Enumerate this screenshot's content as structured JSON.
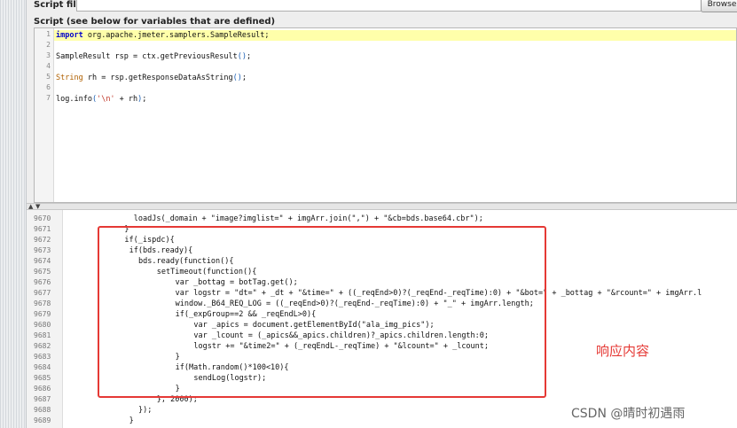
{
  "header": {
    "script_file_label": "Script file",
    "browse_label": "Browse",
    "script_label": "Script (see below for variables that are defined)"
  },
  "editor": {
    "lines": [
      {
        "num": "1",
        "parts": [
          {
            "t": "import",
            "c": "kw"
          },
          {
            "t": " org.apache.jmeter.samplers.SampleResult;",
            "c": ""
          }
        ]
      },
      {
        "num": "2",
        "parts": []
      },
      {
        "num": "3",
        "parts": [
          {
            "t": "SampleResult rsp = ctx.getPreviousResult",
            "c": ""
          },
          {
            "t": "()",
            "c": "paren"
          },
          {
            "t": ";",
            "c": ""
          }
        ]
      },
      {
        "num": "4",
        "parts": []
      },
      {
        "num": "5",
        "parts": [
          {
            "t": "String",
            "c": "type"
          },
          {
            "t": " rh = rsp.getResponseDataAsString",
            "c": ""
          },
          {
            "t": "()",
            "c": "paren"
          },
          {
            "t": ";",
            "c": ""
          }
        ]
      },
      {
        "num": "6",
        "parts": []
      },
      {
        "num": "7",
        "parts": [
          {
            "t": "log.info",
            "c": ""
          },
          {
            "t": "(",
            "c": "paren"
          },
          {
            "t": "'\\n'",
            "c": "str"
          },
          {
            "t": " + rh",
            "c": ""
          },
          {
            "t": ")",
            "c": "paren"
          },
          {
            "t": ";",
            "c": ""
          }
        ]
      }
    ]
  },
  "response": {
    "lines": [
      {
        "num": "9670",
        "indent": 14,
        "text": "loadJs(_domain + \"image?imglist=\" + imgArr.join(\",\") + \"&cb=bds.base64.cbr\");"
      },
      {
        "num": "9671",
        "indent": 12,
        "text": "}"
      },
      {
        "num": "9672",
        "indent": 12,
        "text": "if(_ispdc){"
      },
      {
        "num": "9673",
        "indent": 13,
        "text": "if(bds.ready){"
      },
      {
        "num": "9674",
        "indent": 15,
        "text": "bds.ready(function(){"
      },
      {
        "num": "9675",
        "indent": 19,
        "text": "setTimeout(function(){"
      },
      {
        "num": "9676",
        "indent": 23,
        "text": "var _bottag = botTag.get();"
      },
      {
        "num": "9677",
        "indent": 23,
        "text": "var logstr = \"dt=\" + _dt + \"&time=\" + ((_reqEnd>0)?(_reqEnd-_reqTime):0) + \"&bot=\" + _bottag + \"&rcount=\" + imgArr.l"
      },
      {
        "num": "9678",
        "indent": 23,
        "text": "window._B64_REQ_LOG = ((_reqEnd>0)?(_reqEnd-_reqTime):0) + \"_\" + imgArr.length;"
      },
      {
        "num": "9679",
        "indent": 23,
        "text": "if(_expGroup==2 && _reqEndL>0){"
      },
      {
        "num": "9680",
        "indent": 27,
        "text": "var _apics = document.getElementById(\"ala_img_pics\");"
      },
      {
        "num": "9681",
        "indent": 27,
        "text": "var _lcount = (_apics&&_apics.children)?_apics.children.length:0;"
      },
      {
        "num": "9682",
        "indent": 27,
        "text": "logstr += \"&time2=\" + (_reqEndL-_reqTime) + \"&lcount=\" + _lcount;"
      },
      {
        "num": "9683",
        "indent": 23,
        "text": "}"
      },
      {
        "num": "9684",
        "indent": 23,
        "text": "if(Math.random()*100<10){"
      },
      {
        "num": "9685",
        "indent": 27,
        "text": "sendLog(logstr);"
      },
      {
        "num": "9686",
        "indent": 23,
        "text": "}"
      },
      {
        "num": "9687",
        "indent": 19,
        "text": "}, 2000);"
      },
      {
        "num": "9688",
        "indent": 15,
        "text": "});"
      },
      {
        "num": "9689",
        "indent": 13,
        "text": "}"
      }
    ]
  },
  "annotation": "响应内容",
  "watermark": "CSDN @晴时初遇雨",
  "colors": {
    "highlight_box": "#e53935",
    "current_line": "#ffffaa",
    "keyword": "#0000cc"
  }
}
